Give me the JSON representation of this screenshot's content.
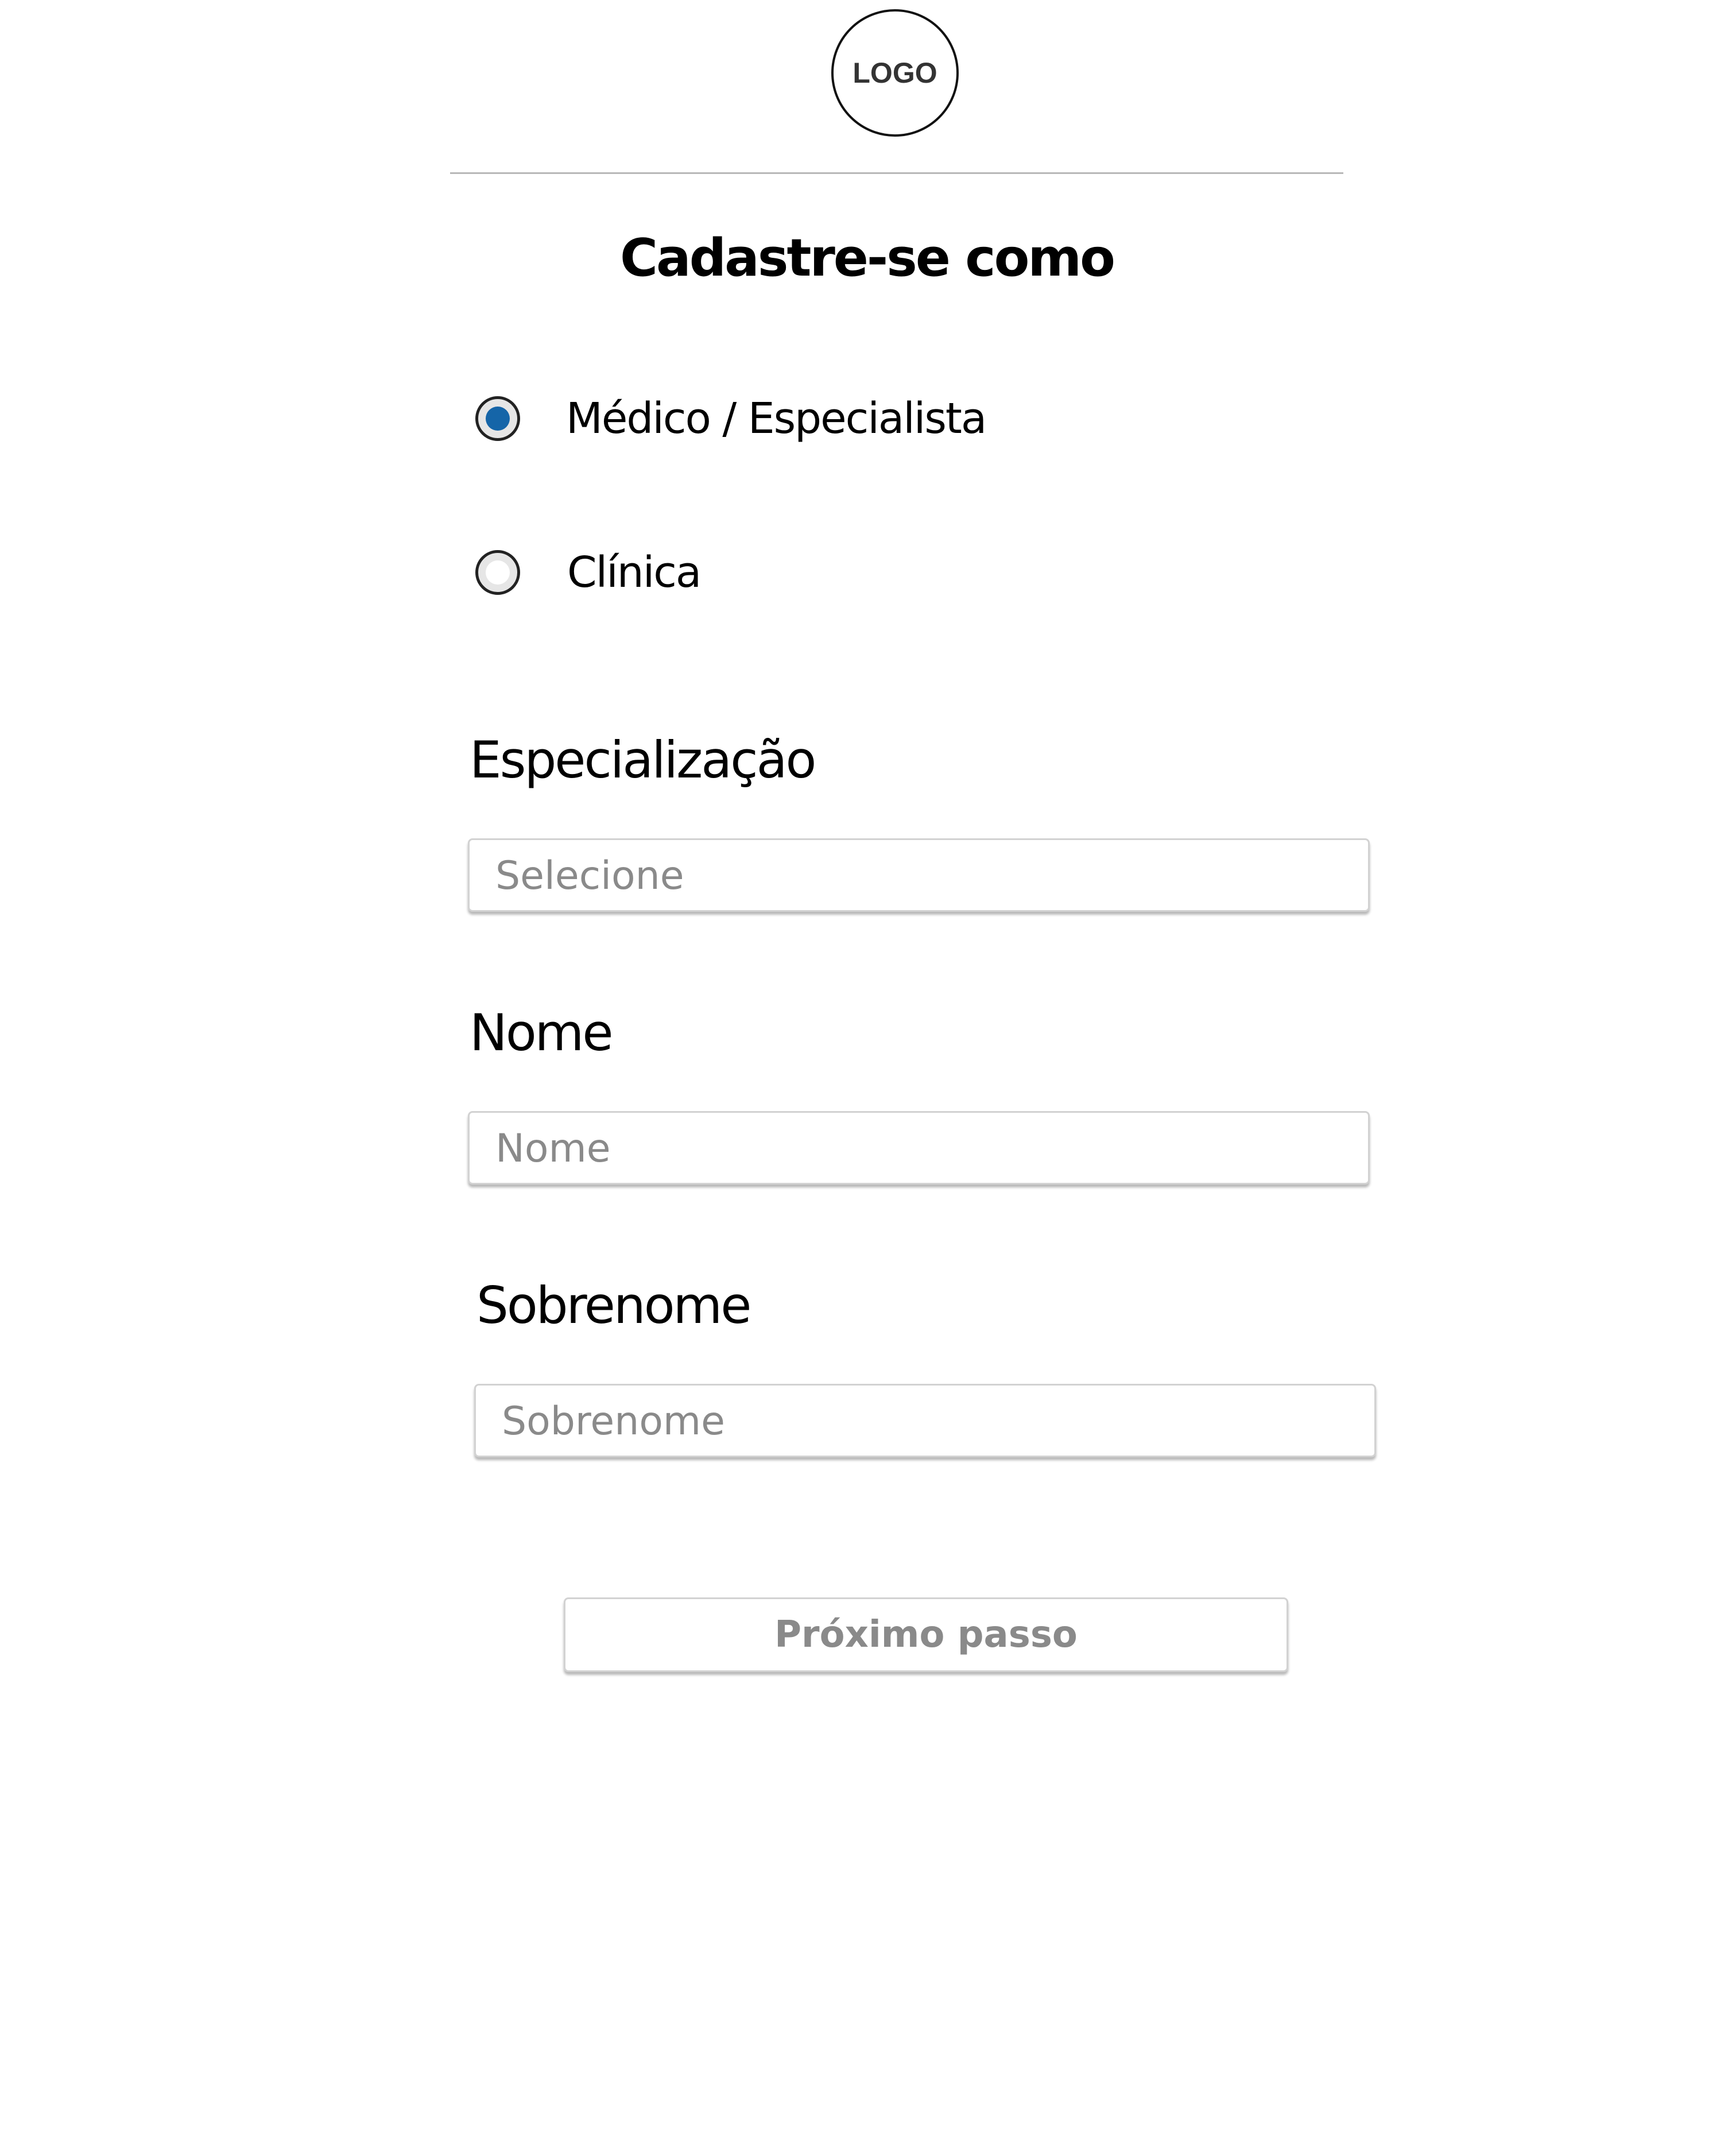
{
  "header": {
    "logo_text": "LOGO"
  },
  "form": {
    "title": "Cadastre-se como",
    "account_type": {
      "options": [
        {
          "label": "Médico  / Especialista",
          "checked": true
        },
        {
          "label": "Clínica",
          "checked": false
        }
      ]
    },
    "specialization": {
      "label": "Especialização",
      "placeholder": "Selecione"
    },
    "first_name": {
      "label": "Nome",
      "placeholder": "Nome"
    },
    "last_name": {
      "label": "Sobrenome",
      "placeholder": "Sobrenome"
    },
    "next_label": "Próximo passo"
  },
  "colors": {
    "accent": "#1565a8",
    "placeholder_text": "#8a8a8a",
    "divider": "#b8b8b8"
  }
}
